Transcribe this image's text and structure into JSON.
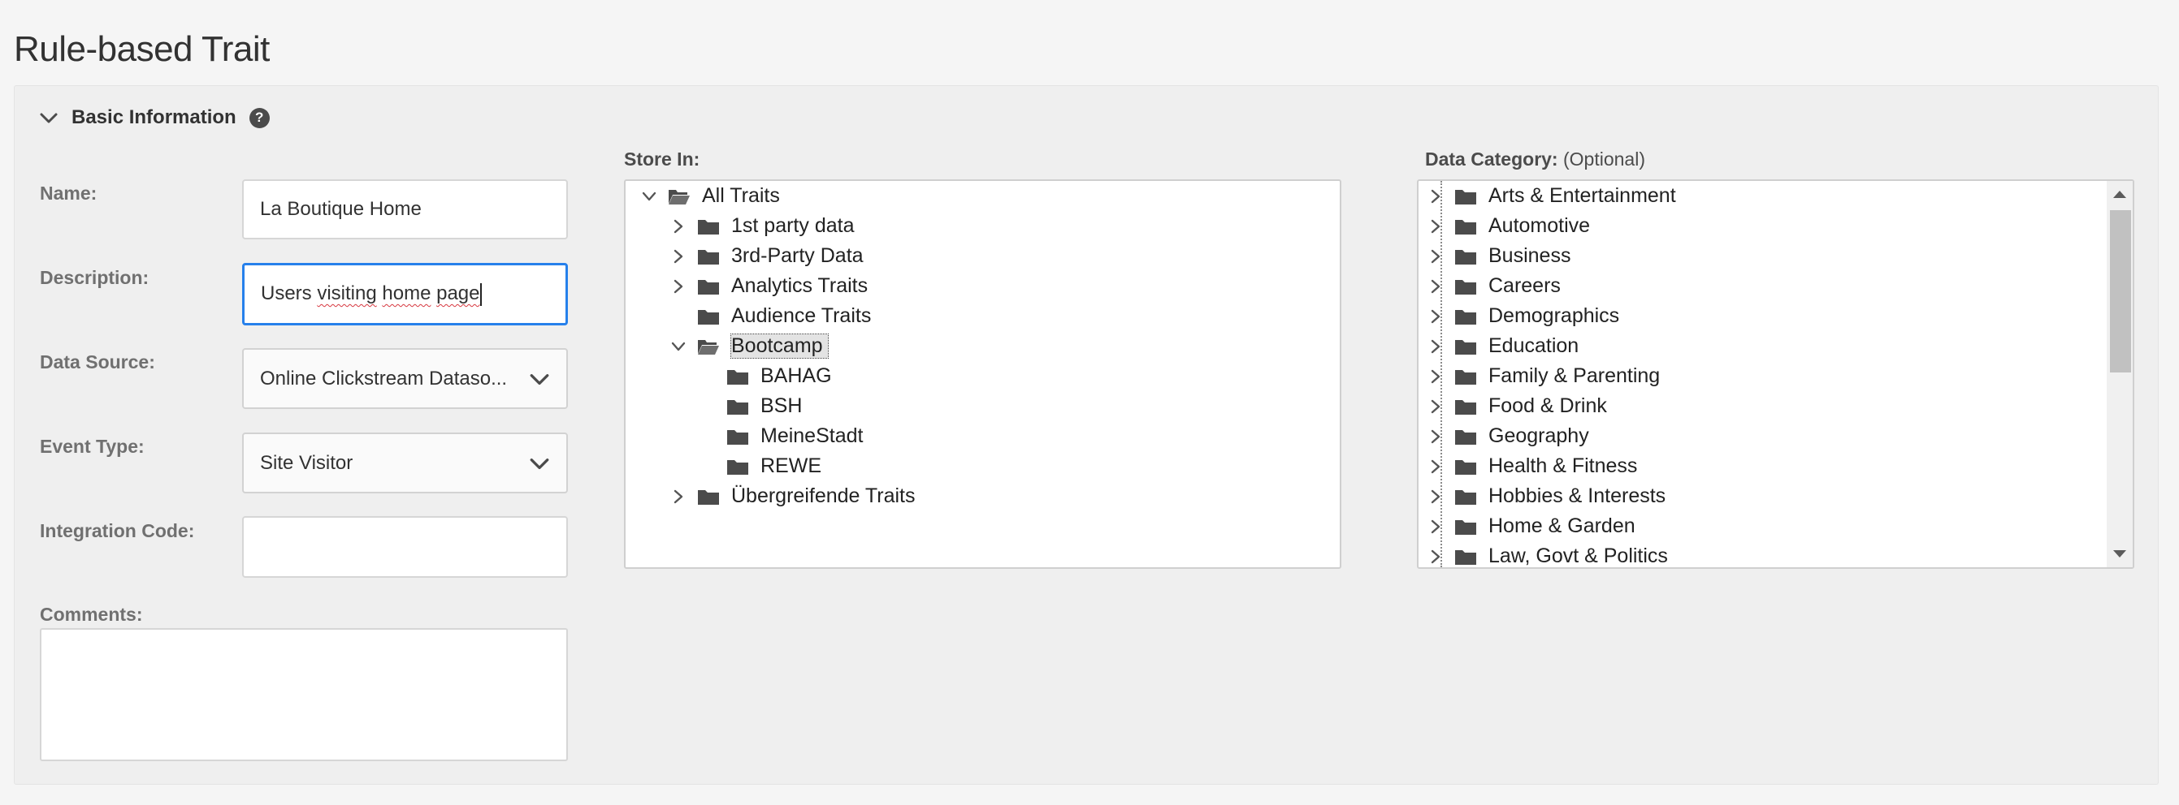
{
  "page": {
    "title": "Rule-based Trait"
  },
  "section": {
    "title": "Basic Information",
    "help_glyph": "?"
  },
  "form": {
    "name_label": "Name:",
    "name_value": "La Boutique Home",
    "description_label": "Description:",
    "description_value": "Users visiting home page",
    "description_plain": "Users ",
    "description_word1": "visiting",
    "description_space1": " ",
    "description_word2": "home",
    "description_space2": " ",
    "description_word3": "page",
    "data_source_label": "Data Source:",
    "data_source_value": "Online Clickstream Dataso...",
    "event_type_label": "Event Type:",
    "event_type_value": "Site Visitor",
    "integration_code_label": "Integration Code:",
    "integration_code_value": "",
    "comments_label": "Comments:",
    "comments_value": ""
  },
  "store_in": {
    "label": "Store In:",
    "items": [
      {
        "label": "All Traits",
        "level": 0,
        "state": "expanded"
      },
      {
        "label": "1st party data",
        "level": 1,
        "state": "collapsed"
      },
      {
        "label": "3rd-Party Data",
        "level": 1,
        "state": "collapsed"
      },
      {
        "label": "Analytics Traits",
        "level": 1,
        "state": "collapsed"
      },
      {
        "label": "Audience Traits",
        "level": 1,
        "state": "leaf"
      },
      {
        "label": "Bootcamp",
        "level": 1,
        "state": "expanded",
        "selected": true
      },
      {
        "label": "BAHAG",
        "level": 2,
        "state": "leaf"
      },
      {
        "label": "BSH",
        "level": 2,
        "state": "leaf"
      },
      {
        "label": "MeineStadt",
        "level": 2,
        "state": "leaf"
      },
      {
        "label": "REWE",
        "level": 2,
        "state": "leaf"
      },
      {
        "label": "Übergreifende Traits",
        "level": 1,
        "state": "collapsed"
      }
    ]
  },
  "data_category": {
    "label": "Data Category:",
    "optional": "(Optional)",
    "items": [
      {
        "label": "Arts & Entertainment"
      },
      {
        "label": "Automotive"
      },
      {
        "label": "Business"
      },
      {
        "label": "Careers"
      },
      {
        "label": "Demographics"
      },
      {
        "label": "Education"
      },
      {
        "label": "Family & Parenting"
      },
      {
        "label": "Food & Drink"
      },
      {
        "label": "Geography"
      },
      {
        "label": "Health & Fitness"
      },
      {
        "label": "Hobbies & Interests"
      },
      {
        "label": "Home & Garden"
      },
      {
        "label": "Law, Govt & Politics"
      }
    ]
  },
  "colors": {
    "focus": "#2680eb",
    "selected_bg": "#e3e3e3",
    "folder": "#4b4b4b"
  },
  "icons": {
    "section_toggle": "chevron-down-icon",
    "help": "help-icon",
    "select": "chevron-down-icon",
    "tree_expand": "chevron-right-icon",
    "tree_collapse": "chevron-down-icon",
    "folder": "folder-icon",
    "folder_open": "folder-open-icon"
  }
}
